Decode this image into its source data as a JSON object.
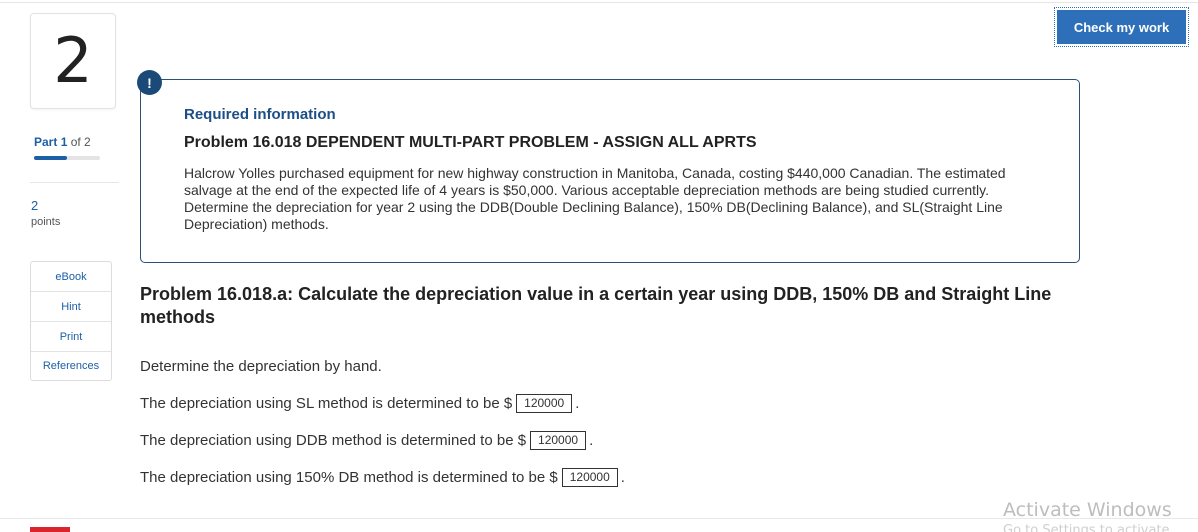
{
  "question": {
    "number": "2"
  },
  "part": {
    "label": "Part",
    "current": "1",
    "of_text": "of 2",
    "progress": 0.5
  },
  "points": {
    "value": "2",
    "label": "points"
  },
  "tools": [
    "eBook",
    "Hint",
    "Print",
    "References"
  ],
  "header": {
    "check_button": "Check my work"
  },
  "alert": {
    "icon_glyph": "!"
  },
  "info": {
    "required_label": "Required information",
    "problem_title": "Problem 16.018 DEPENDENT MULTI-PART PROBLEM - ASSIGN ALL APRTS",
    "description": "Halcrow Yolles purchased equipment for new highway construction in Manitoba, Canada, costing $440,000 Canadian. The estimated salvage at the end of the expected life of 4 years is $50,000. Various acceptable depreciation methods are being studied currently. Determine the depreciation for year 2 using the DDB(Double Declining Balance), 150% DB(Declining Balance), and SL(Straight Line Depreciation) methods."
  },
  "part_title": "Problem 16.018.a: Calculate the depreciation value in a certain year using DDB, 150% DB and Straight Line methods",
  "instruction": "Determine the depreciation by hand.",
  "answers": [
    {
      "prefix": "The depreciation using SL method is determined to be $",
      "value": "120000",
      "suffix": "."
    },
    {
      "prefix": "The depreciation using DDB method is determined to be $",
      "value": "120000",
      "suffix": "."
    },
    {
      "prefix": "The depreciation using 150% DB method is determined to be $",
      "value": "120000",
      "suffix": "."
    }
  ],
  "watermark": {
    "title": "Activate Windows",
    "subtitle": "Go to Settings to activate Windows."
  }
}
